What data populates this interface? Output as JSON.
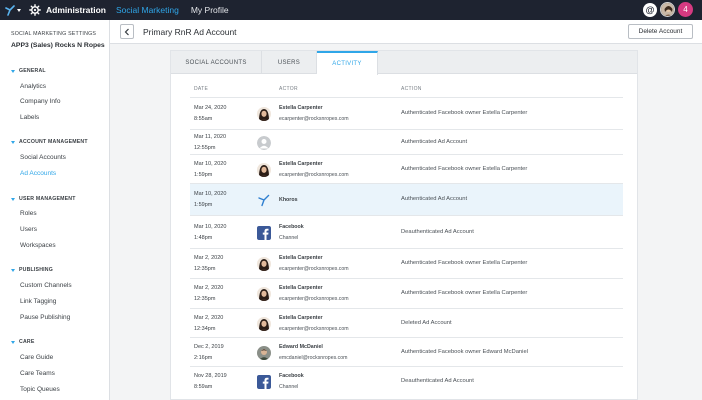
{
  "topbar": {
    "title": "Administration",
    "nav": [
      "Social Marketing",
      "My Profile"
    ],
    "at_symbol": "@",
    "notifications": "4"
  },
  "sidebar": {
    "caption": "SOCIAL MARKETING SETTINGS",
    "account": "APP3 (Sales) Rocks N Ropes",
    "sections": [
      {
        "label": "GENERAL",
        "items": [
          "Analytics",
          "Company Info",
          "Labels"
        ]
      },
      {
        "label": "ACCOUNT MANAGEMENT",
        "items": [
          "Social Accounts",
          "Ad Accounts"
        ]
      },
      {
        "label": "USER MANAGEMENT",
        "items": [
          "Roles",
          "Users",
          "Workspaces"
        ]
      },
      {
        "label": "PUBLISHING",
        "items": [
          "Custom Channels",
          "Link Tagging",
          "Pause Publishing"
        ]
      },
      {
        "label": "CARE",
        "items": [
          "Care Guide",
          "Care Teams",
          "Topic Queues"
        ]
      }
    ],
    "active_item": "Ad Accounts"
  },
  "header": {
    "title": "Primary RnR Ad Account",
    "delete_label": "Delete Account"
  },
  "tabs": [
    "SOCIAL ACCOUNTS",
    "USERS",
    "ACTIVITY"
  ],
  "active_tab": "ACTIVITY",
  "columns": [
    "DATE",
    "ACTOR",
    "ACTION"
  ],
  "rows": [
    {
      "date": "Mar 24, 2020",
      "time": "8:55am",
      "actor": "Estella Carpenter",
      "sub": "ecarpenter@rocksnropes.com",
      "action": "Authenticated Facebook owner Estella Carpenter",
      "avatar": "estella"
    },
    {
      "date": "Mar 11, 2020",
      "time": "12:55pm",
      "actor": "",
      "sub": "",
      "action": "Authenticated Ad Account",
      "avatar": "placeholder"
    },
    {
      "date": "Mar 10, 2020",
      "time": "1:59pm",
      "actor": "Estella Carpenter",
      "sub": "ecarpenter@rocksnropes.com",
      "action": "Authenticated Facebook owner Estella Carpenter",
      "avatar": "estella"
    },
    {
      "date": "Mar 10, 2020",
      "time": "1:59pm",
      "actor": "Khoros",
      "sub": "",
      "action": "Authenticated Ad Account",
      "avatar": "khoros",
      "highlight": true
    },
    {
      "date": "Mar 10, 2020",
      "time": "1:48pm",
      "actor": "Facebook",
      "sub": "Channel",
      "action": "Deauthenticated Ad Account",
      "avatar": "facebook"
    },
    {
      "date": "Mar 2, 2020",
      "time": "12:35pm",
      "actor": "Estella Carpenter",
      "sub": "ecarpenter@rocksnropes.com",
      "action": "Authenticated Facebook owner Estella Carpenter",
      "avatar": "estella"
    },
    {
      "date": "Mar 2, 2020",
      "time": "12:35pm",
      "actor": "Estella Carpenter",
      "sub": "ecarpenter@rocksnropes.com",
      "action": "Authenticated Facebook owner Estella Carpenter",
      "avatar": "estella"
    },
    {
      "date": "Mar 2, 2020",
      "time": "12:34pm",
      "actor": "Estella Carpenter",
      "sub": "ecarpenter@rocksnropes.com",
      "action": "Deleted Ad Account",
      "avatar": "estella"
    },
    {
      "date": "Dec 2, 2019",
      "time": "2:16pm",
      "actor": "Edward McDaniel",
      "sub": "emcdaniel@rocksnropes.com",
      "action": "Authenticated Facebook owner Edward McDaniel",
      "avatar": "edward"
    },
    {
      "date": "Nov 28, 2019",
      "time": "8:59am",
      "actor": "Facebook",
      "sub": "Channel",
      "action": "Deauthenticated Ad Account",
      "avatar": "facebook"
    }
  ],
  "colors": {
    "accent": "#2fa6e8",
    "topbar": "#1e2330",
    "highlight_row": "#eaf4fb",
    "facebook": "#3b5998",
    "notification": "#d63a81"
  },
  "icons": [
    "app-switcher-icon",
    "gear-icon",
    "chevron-left-icon",
    "facebook-icon",
    "khoros-icon",
    "person-placeholder-icon"
  ]
}
